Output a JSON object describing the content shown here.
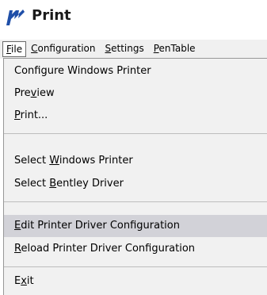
{
  "window": {
    "title": "Print",
    "icon": "bentley-logo-icon",
    "accent_color": "#1f4fa8"
  },
  "menubar": {
    "items": [
      {
        "pre": "",
        "key": "F",
        "post": "ile"
      },
      {
        "pre": "",
        "key": "C",
        "post": "onfiguration"
      },
      {
        "pre": "",
        "key": "S",
        "post": "ettings"
      },
      {
        "pre": "",
        "key": "P",
        "post": "enTable"
      }
    ]
  },
  "file_menu": {
    "items": [
      {
        "pre": "Configure Windows Printer",
        "key": "",
        "post": ""
      },
      {
        "pre": "Pre",
        "key": "v",
        "post": "iew"
      },
      {
        "pre": "",
        "key": "P",
        "post": "rint..."
      },
      {
        "pre": "Select ",
        "key": "W",
        "post": "indows Printer"
      },
      {
        "pre": "Select ",
        "key": "B",
        "post": "entley Driver"
      },
      {
        "pre": "",
        "key": "E",
        "post": "dit Printer Driver Configuration"
      },
      {
        "pre": "",
        "key": "R",
        "post": "eload Printer Driver Configuration"
      },
      {
        "pre": "E",
        "key": "x",
        "post": "it"
      }
    ],
    "highlight_color": "#d2d2d8"
  }
}
